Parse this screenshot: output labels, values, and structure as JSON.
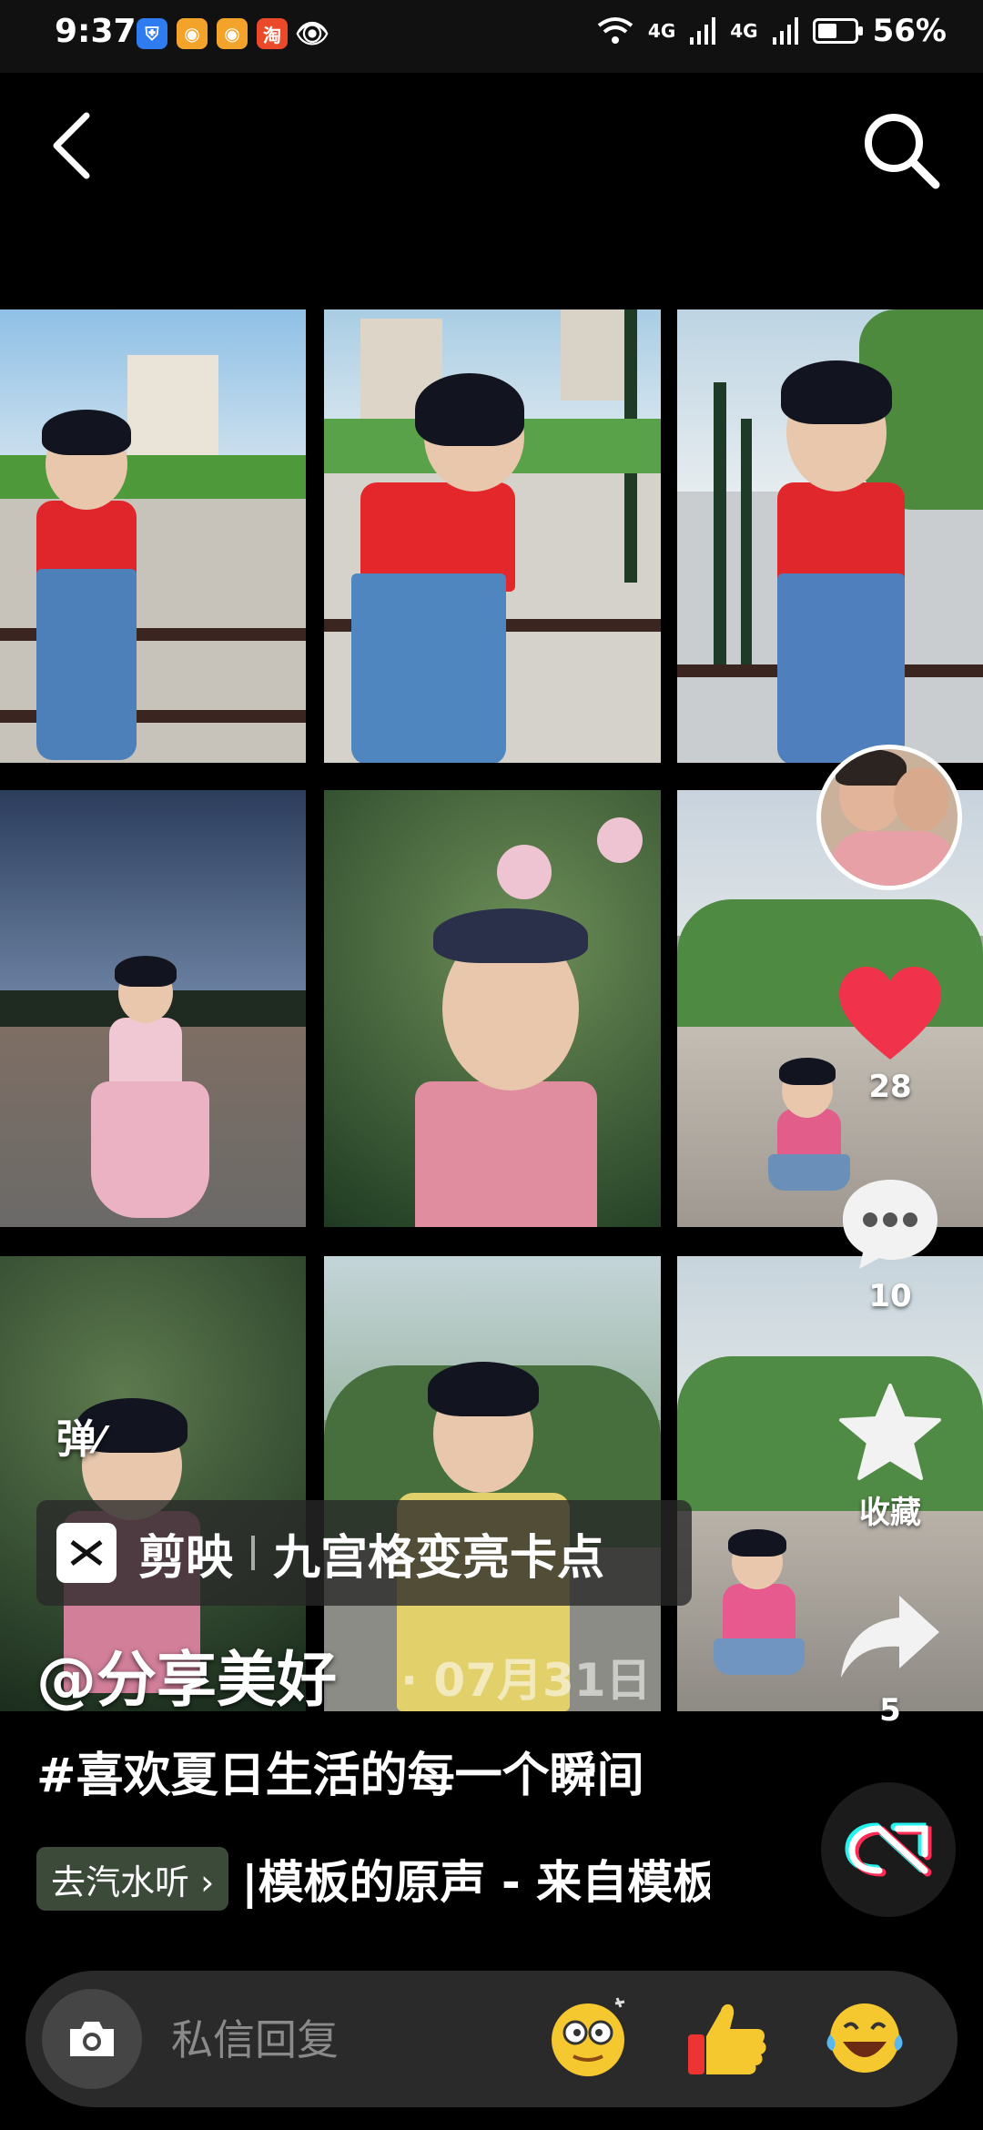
{
  "status_bar": {
    "time": "9:37",
    "signal1": "4G",
    "signal2": "4G",
    "battery": "56%",
    "taobao": "淘"
  },
  "actions": {
    "likes": "28",
    "comments": "10",
    "favorite_label": "收藏",
    "shares": "5"
  },
  "overlay": {
    "danmu": "弹",
    "template_app": "剪映",
    "template_name": "九宫格变亮卡点",
    "author": "@分享美好",
    "date": "· 07月31日",
    "hashtag": "#喜欢夏日生活的每一个瞬间",
    "qishui_label": "去汽水听 ›",
    "music": "|模板的原声 - 来自模板"
  },
  "comment_bar": {
    "placeholder": "私信回复"
  },
  "colors": {
    "like": "#f0334a",
    "background": "#000000",
    "comment_bar": "#2a2a2a"
  },
  "icons": [
    "back-arrow-icon",
    "search-icon",
    "heart-icon",
    "comment-bubble-icon",
    "star-icon",
    "share-arrow-icon",
    "camera-icon",
    "capcut-icon"
  ]
}
